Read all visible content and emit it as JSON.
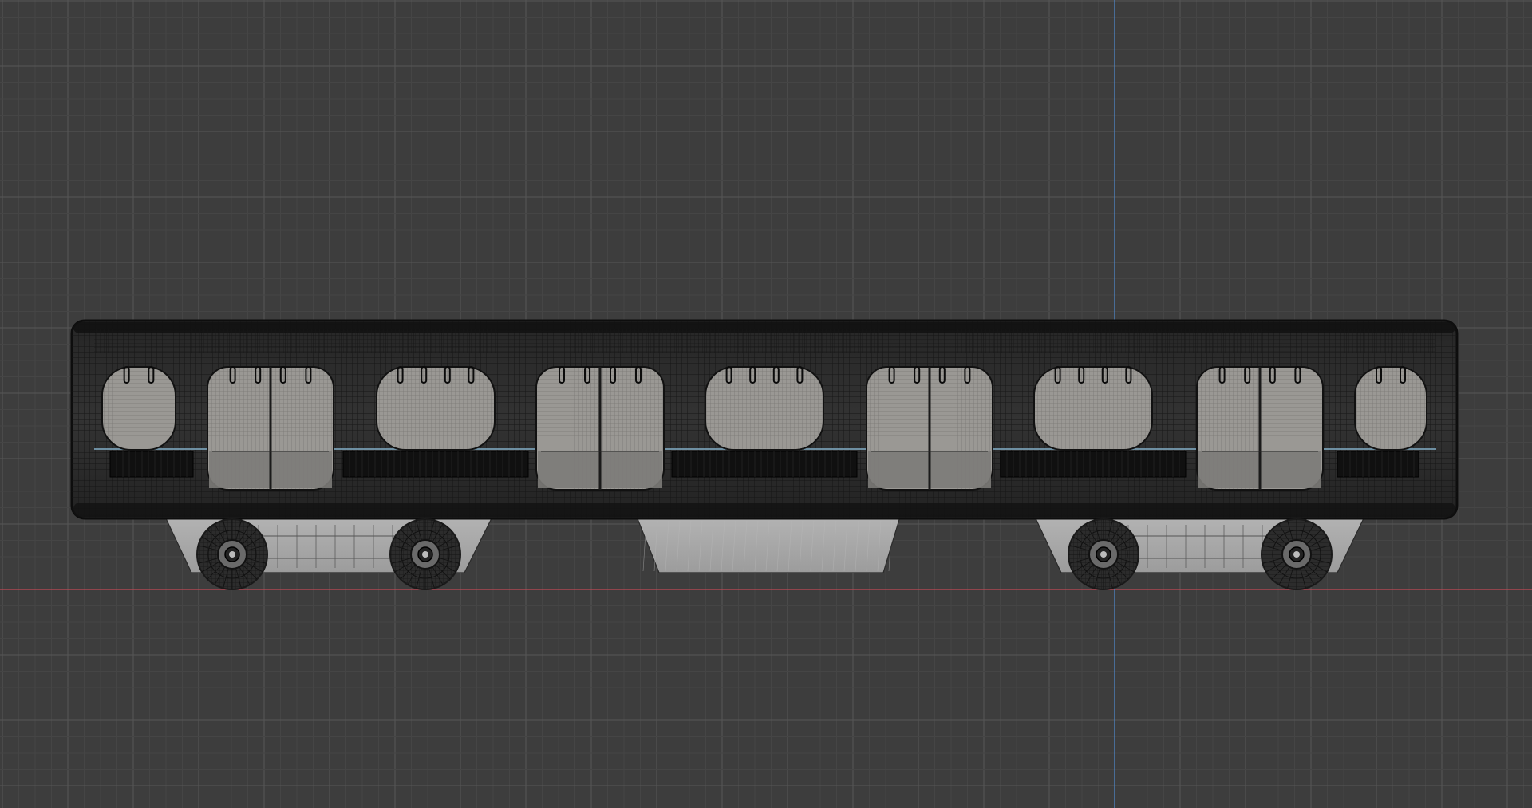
{
  "viewport": {
    "background": "#3d3d3d",
    "grid_minor_color": "#454545",
    "grid_major_color": "#565656",
    "x_axis_color": "#c24a55",
    "y_axis_color": "#4f86c6"
  },
  "model": {
    "body_fill": "#2b2b2b",
    "wire_color": "#151515",
    "window_fill": "#9a9894",
    "window_lower_fill": "#7c7b78",
    "band_fill": "#101010",
    "accent_color": "#7fa8c0",
    "undercarriage_fill": "#a8a8a8",
    "wheel_color": "#1a1a1a"
  }
}
